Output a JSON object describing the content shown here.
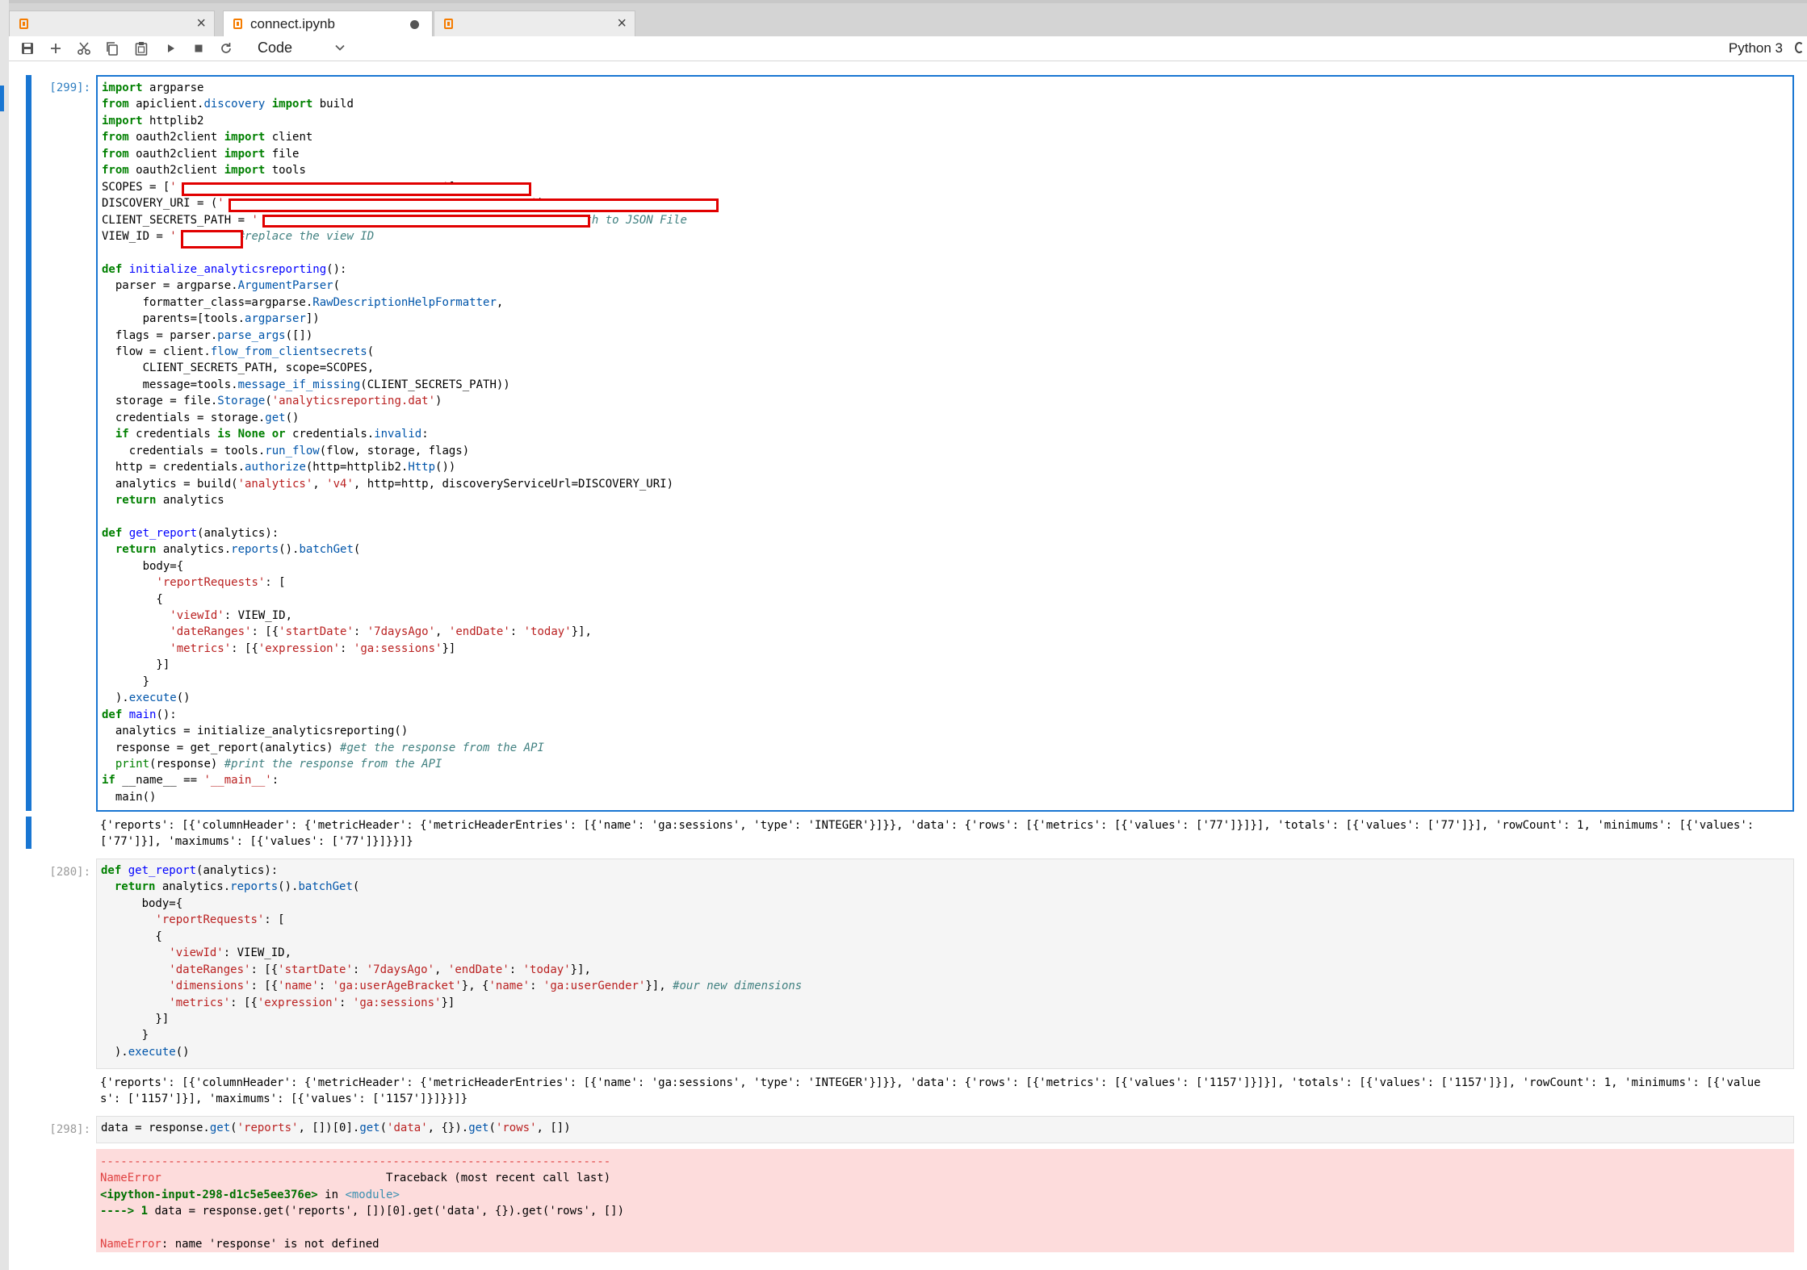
{
  "tabs": [
    {
      "label": "",
      "icon": "notebook-icon",
      "close": "×"
    },
    {
      "label": "connect.ipynb",
      "icon": "notebook-icon",
      "unsaved": true
    },
    {
      "label": "",
      "icon": "notebook-icon",
      "close": "×"
    }
  ],
  "toolbar": {
    "buttons": [
      "save-icon",
      "add-icon",
      "cut-icon",
      "copy-icon",
      "paste-icon",
      "run-icon",
      "stop-icon",
      "restart-icon"
    ],
    "cell_type": "Code",
    "kernel": "Python 3"
  },
  "cells": [
    {
      "prompt": "[299]:",
      "code": "import argparse\nfrom apiclient.discovery import build\nimport httplib2\nfrom oauth2client import client\nfrom oauth2client import file\nfrom oauth2client import tools\nSCOPES = ['                                       ']\nDISCOVERY_URI = ('                                             ')\nCLIENT_SECRETS_PATH = '                          ' #replace with the path to JSON File\nVIEW_ID = '       ' #replace the view ID\n\ndef initialize_analyticsreporting():\n  parser = argparse.ArgumentParser(\n      formatter_class=argparse.RawDescriptionHelpFormatter,\n      parents=[tools.argparser])\n  flags = parser.parse_args([])\n  flow = client.flow_from_clientsecrets(\n      CLIENT_SECRETS_PATH, scope=SCOPES,\n      message=tools.message_if_missing(CLIENT_SECRETS_PATH))\n  storage = file.Storage('analyticsreporting.dat')\n  credentials = storage.get()\n  if credentials is None or credentials.invalid:\n    credentials = tools.run_flow(flow, storage, flags)\n  http = credentials.authorize(http=httplib2.Http())\n  analytics = build('analytics', 'v4', http=http, discoveryServiceUrl=DISCOVERY_URI)\n  return analytics\n\ndef get_report(analytics):\n  return analytics.reports().batchGet(\n      body={\n        'reportRequests': [\n        {\n          'viewId': VIEW_ID,\n          'dateRanges': [{'startDate': '7daysAgo', 'endDate': 'today'}],\n          'metrics': [{'expression': 'ga:sessions'}]\n        }]\n      }\n  ).execute()\ndef main():\n  analytics = initialize_analyticsreporting()\n  response = get_report(analytics) #get the response from the API\n  print(response) #print the response from the API\nif __name__ == '__main__':\n  main()",
      "output": "{'reports': [{'columnHeader': {'metricHeader': {'metricHeaderEntries': [{'name': 'ga:sessions', 'type': 'INTEGER'}]}}, 'data': {'rows': [{'metrics': [{'values': ['77']}]}], 'totals': [{'values': ['77']}], 'rowCount': 1, 'minimums': [{'values':\n['77']}], 'maximums': [{'values': ['77']}]}}]}"
    },
    {
      "prompt": "[280]:",
      "code": "def get_report(analytics):\n  return analytics.reports().batchGet(\n      body={\n        'reportRequests': [\n        {\n          'viewId': VIEW_ID,\n          'dateRanges': [{'startDate': '7daysAgo', 'endDate': 'today'}],\n          'dimensions': [{'name': 'ga:userAgeBracket'}, {'name': 'ga:userGender'}], #our new dimensions\n          'metrics': [{'expression': 'ga:sessions'}]\n        }]\n      }\n  ).execute()",
      "output": "{'reports': [{'columnHeader': {'metricHeader': {'metricHeaderEntries': [{'name': 'ga:sessions', 'type': 'INTEGER'}]}}, 'data': {'rows': [{'metrics': [{'values': ['1157']}]}], 'totals': [{'values': ['1157']}], 'rowCount': 1, 'minimums': [{'value\ns': ['1157']}], 'maximums': [{'values': ['1157']}]}}]}"
    },
    {
      "prompt": "[298]:",
      "code": "data = response.get('reports', [])[0].get('data', {}).get('rows', [])",
      "error": {
        "rule": "---------------------------------------------------------------------------",
        "name": "NameError",
        "traceback_label": "Traceback (most recent call last)",
        "location": "<ipython-input-298-d1c5e5ee376e>",
        "in": "in",
        "module": "<module>",
        "arrow": "----> 1",
        "line": "data = response.get('reports', [])[0].get('data', {}).get('rows', [])",
        "message": "name 'response' is not defined"
      }
    }
  ]
}
